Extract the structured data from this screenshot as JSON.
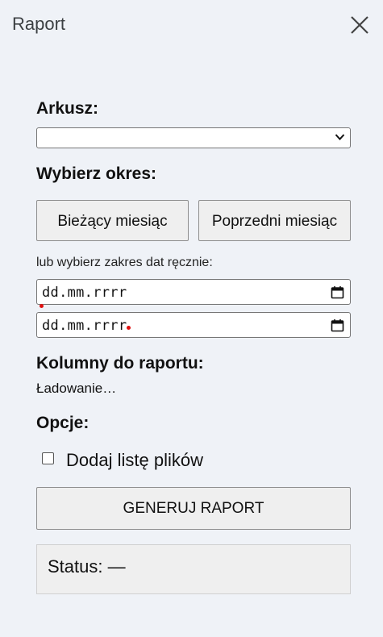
{
  "header": {
    "title": "Raport"
  },
  "form": {
    "sheet_label": "Arkusz:",
    "sheet_value": "",
    "period_label": "Wybierz okres:",
    "btn_current": "Bieżący miesiąc",
    "btn_previous": "Poprzedni miesiąc",
    "manual_hint": "lub wybierz zakres dat ręcznie:",
    "date_from": "dd.mm.rrrr",
    "date_to": "dd.mm.rrrr",
    "columns_label": "Kolumny do raportu:",
    "columns_loading": "Ładowanie…",
    "options_label": "Opcje:",
    "checkbox_label": "Dodaj listę plików",
    "checkbox_checked": false,
    "generate_label": "GENERUJ RAPORT",
    "status_text": "Status: —"
  },
  "icons": {
    "close": "close-icon",
    "dropdown": "chevron-down-icon",
    "calendar": "calendar-icon"
  },
  "colors": {
    "background": "#eff2f7",
    "button": "#efefef",
    "validation_dot": "#e01010"
  }
}
